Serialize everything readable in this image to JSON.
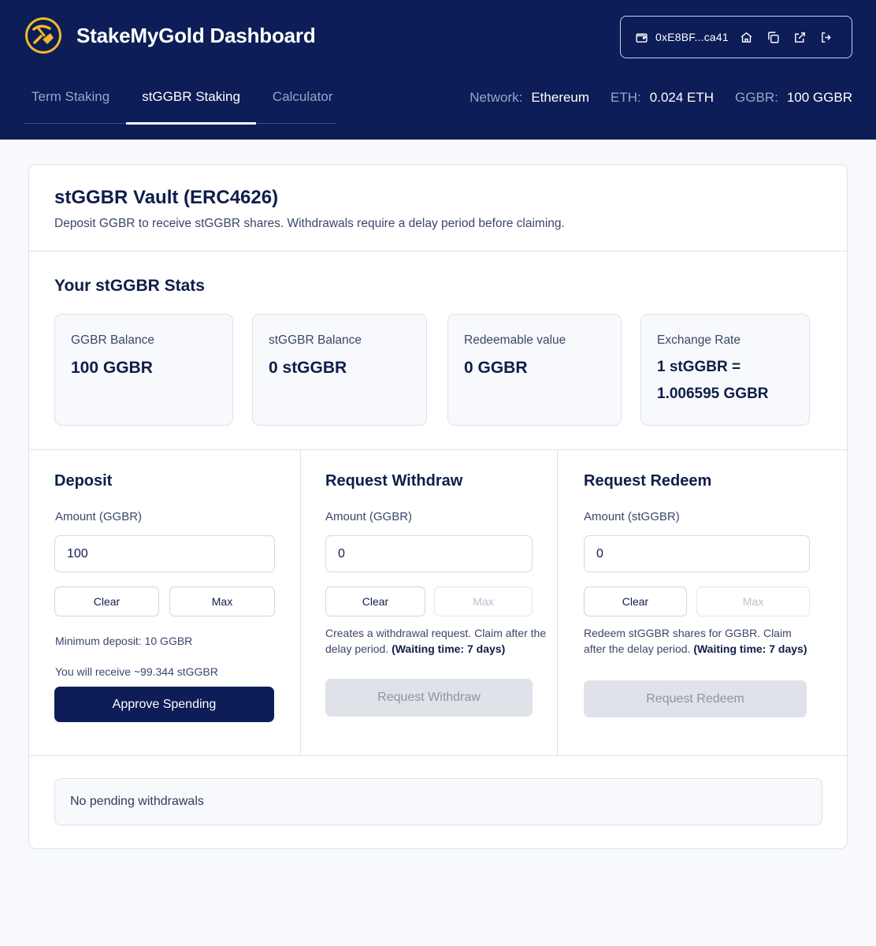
{
  "app": {
    "title": "StakeMyGold Dashboard"
  },
  "wallet": {
    "address": "0xE8BF...ca41"
  },
  "tabs": [
    {
      "label": "Term Staking",
      "active": false
    },
    {
      "label": "stGGBR Staking",
      "active": true
    },
    {
      "label": "Calculator",
      "active": false
    }
  ],
  "network": {
    "network_label": "Network:",
    "network_value": "Ethereum",
    "eth_label": "ETH:",
    "eth_value": "0.024 ETH",
    "ggbr_label": "GGBR:",
    "ggbr_value": "100 GGBR"
  },
  "vault": {
    "title": "stGGBR Vault (ERC4626)",
    "subtitle": "Deposit GGBR to receive stGGBR shares. Withdrawals require a delay period before claiming."
  },
  "stats": {
    "title": "Your stGGBR Stats",
    "items": [
      {
        "label": "GGBR Balance",
        "value": "100 GGBR"
      },
      {
        "label": "stGGBR Balance",
        "value": "0 stGGBR"
      },
      {
        "label": "Redeemable value",
        "value": "0 GGBR"
      },
      {
        "label": "Exchange Rate",
        "value_line1": "1 stGGBR =",
        "value_line2": "1.006595 GGBR"
      }
    ]
  },
  "deposit": {
    "title": "Deposit",
    "amount_label": "Amount (GGBR)",
    "amount_value": "100",
    "clear_label": "Clear",
    "max_label": "Max",
    "min_note": "Minimum deposit: 10 GGBR",
    "receive_note": "You will receive ~99.344 stGGBR",
    "approve_label": "Approve Spending"
  },
  "withdraw": {
    "title": "Request Withdraw",
    "amount_label": "Amount (GGBR)",
    "amount_value": "0",
    "clear_label": "Clear",
    "max_label": "Max",
    "note_line1": "Creates a withdrawal request. Claim after the",
    "note_line2": "delay period.",
    "note_bold": "(Waiting time: 7 days)",
    "button_label": "Request Withdraw"
  },
  "redeem": {
    "title": "Request Redeem",
    "amount_label": "Amount (stGGBR)",
    "amount_value": "0",
    "clear_label": "Clear",
    "max_label": "Max",
    "note_line1": "Redeem stGGBR shares for GGBR. Claim",
    "note_line2": "after the delay period.",
    "note_bold": "(Waiting time: 7 days)",
    "button_label": "Request Redeem"
  },
  "pending": {
    "text": "No pending withdrawals"
  },
  "colors": {
    "header_bg": "#0c1d57",
    "accent_gold": "#f0b92a",
    "primary_button": "#0c1d57"
  }
}
